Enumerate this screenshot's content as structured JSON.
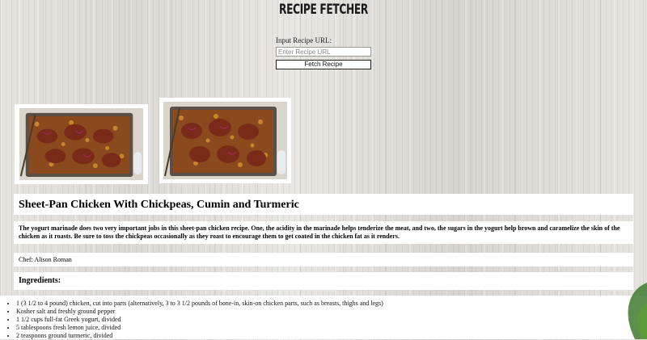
{
  "app": {
    "title": "RECIPE FETCHER"
  },
  "form": {
    "label": "Input Recipe URL:",
    "input_placeholder": "Enter Recipe URL",
    "input_value": "",
    "fetch_label": "Fetch Recipe"
  },
  "recipe": {
    "title": "Sheet-Pan Chicken With Chickpeas, Cumin and Turmeric",
    "description": "The yogurt marinade does two very important jobs in this sheet-pan chicken recipe. One, the acidity in the marinade helps tenderize the meat, and two, the sugars in the yogurt help brown and caramelize the skin of the chicken as it roasts. Be sure to toss the chickpeas occasionally as they roast to encourage them to get coated in the chicken fat as it renders.",
    "chef": "Chef: Alison Roman",
    "ingredients_heading": "Ingredients:",
    "ingredients": [
      "1 (3 1/2 to 4 pound) chicken, cut into parts (alternatively, 3 to 3 1/2 pounds of bone-in, skin-on chicken parts, such as breasts, thighs and legs)",
      "Kosher salt and freshly ground pepper",
      "1 1/2 cups full-fat Greek yogurt, divided",
      "5 tablespoons fresh lemon juice, divided",
      "2 teaspoons ground turmeric, divided"
    ]
  },
  "icons": {
    "photo": "food-photo",
    "leaf": "leaf-decoration"
  },
  "colors": {
    "card": "#ffffff",
    "text": "#111111",
    "tray": "#5a5048",
    "chicken": "#7a2a18",
    "chickpea": "#c8862c"
  }
}
